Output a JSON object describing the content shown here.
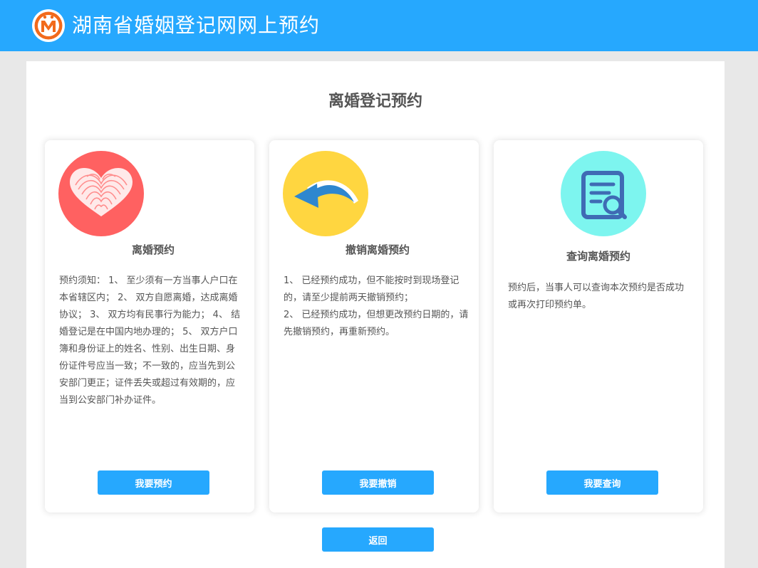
{
  "header": {
    "title": "湖南省婚姻登记网网上预约"
  },
  "page": {
    "title": "离婚登记预约"
  },
  "cards": [
    {
      "icon": "fingerprint-heart-icon",
      "title": "离婚预约",
      "paragraphs": [
        "预约须知： 1、 至少须有一方当事人户口在本省辖区内； 2、 双方自愿离婚，达成离婚协议； 3、 双方均有民事行为能力； 4、 结婚登记是在中国内地办理的； 5、 双方户口簿和身份证上的姓名、性别、出生日期、身份证件号应当一致；不一致的，应当先到公安部门更正；证件丢失或超过有效期的，应当到公安部门补办证件。"
      ],
      "button": "我要预约"
    },
    {
      "icon": "undo-arrow-icon",
      "title": "撤销离婚预约",
      "paragraphs": [
        "1、 已经预约成功，但不能按时到现场登记的，请至少提前两天撤销预约；",
        "2、 已经预约成功，但想更改预约日期的，请先撤销预约，再重新预约。"
      ],
      "button": "我要撤销"
    },
    {
      "icon": "document-search-icon",
      "title": "查询离婚预约",
      "paragraphs": [
        "预约后，当事人可以查询本次预约是否成功或再次打印预约单。"
      ],
      "button": "我要查询"
    }
  ],
  "back_button": "返回",
  "colors": {
    "header_bg": "#26a8fe",
    "button_bg": "#26a8fe",
    "heart_circle": "#ff6161",
    "arrow_circle": "#ffd640",
    "search_circle": "#7df5ef"
  }
}
